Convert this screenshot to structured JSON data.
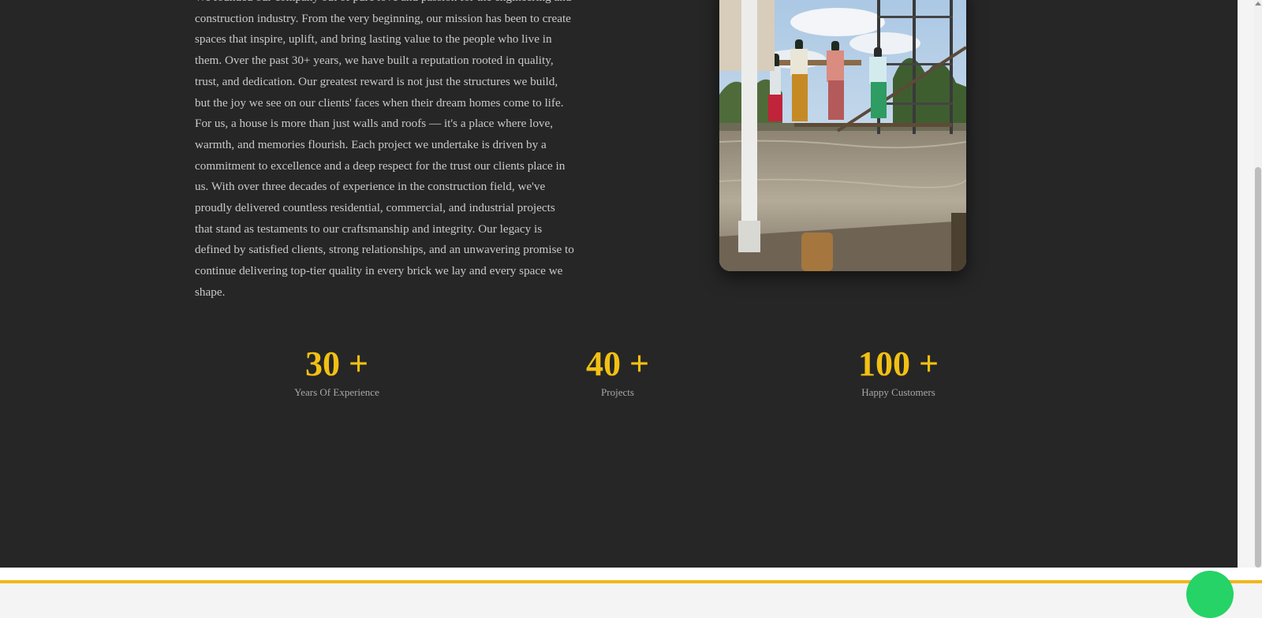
{
  "about": {
    "paragraph_lines": [
      "We founded our company out of pure love and passion for the engineering and",
      "construction industry. From the very beginning, our mission has been to create",
      "spaces that inspire, uplift, and bring lasting value to the people who live in",
      "them. Over the past 30+ years, we have built a reputation rooted in quality,",
      "trust, and dedication. Our greatest reward is not just the structures we build,",
      "but the joy we see on our clients' faces when their dream homes come to life.",
      "For us, a house is more than just walls and roofs — it's a place where love,",
      "warmth, and memories flourish. Each project we undertake is driven by a",
      "commitment to excellence and a deep respect for the trust our clients place in",
      "us. With over three decades of experience in the construction field, we've",
      "proudly delivered countless residential, commercial, and industrial projects",
      "that stand as testaments to our craftsmanship and integrity. Our legacy is",
      "defined by satisfied clients, strong relationships, and an unwavering promise to",
      "continue delivering top-tier quality in every brick we lay and every space we",
      "shape."
    ]
  },
  "stats": [
    {
      "value": "30 +",
      "label": "Years Of Experience"
    },
    {
      "value": "40 +",
      "label": "Projects"
    },
    {
      "value": "100 +",
      "label": "Happy Customers"
    }
  ],
  "colors": {
    "background": "#262626",
    "accent": "#f2c014",
    "body_text": "#c9c9c9",
    "footer_line": "#f2b619",
    "whatsapp": "#25d366"
  },
  "icons": {
    "floating_button": "whatsapp-icon"
  }
}
